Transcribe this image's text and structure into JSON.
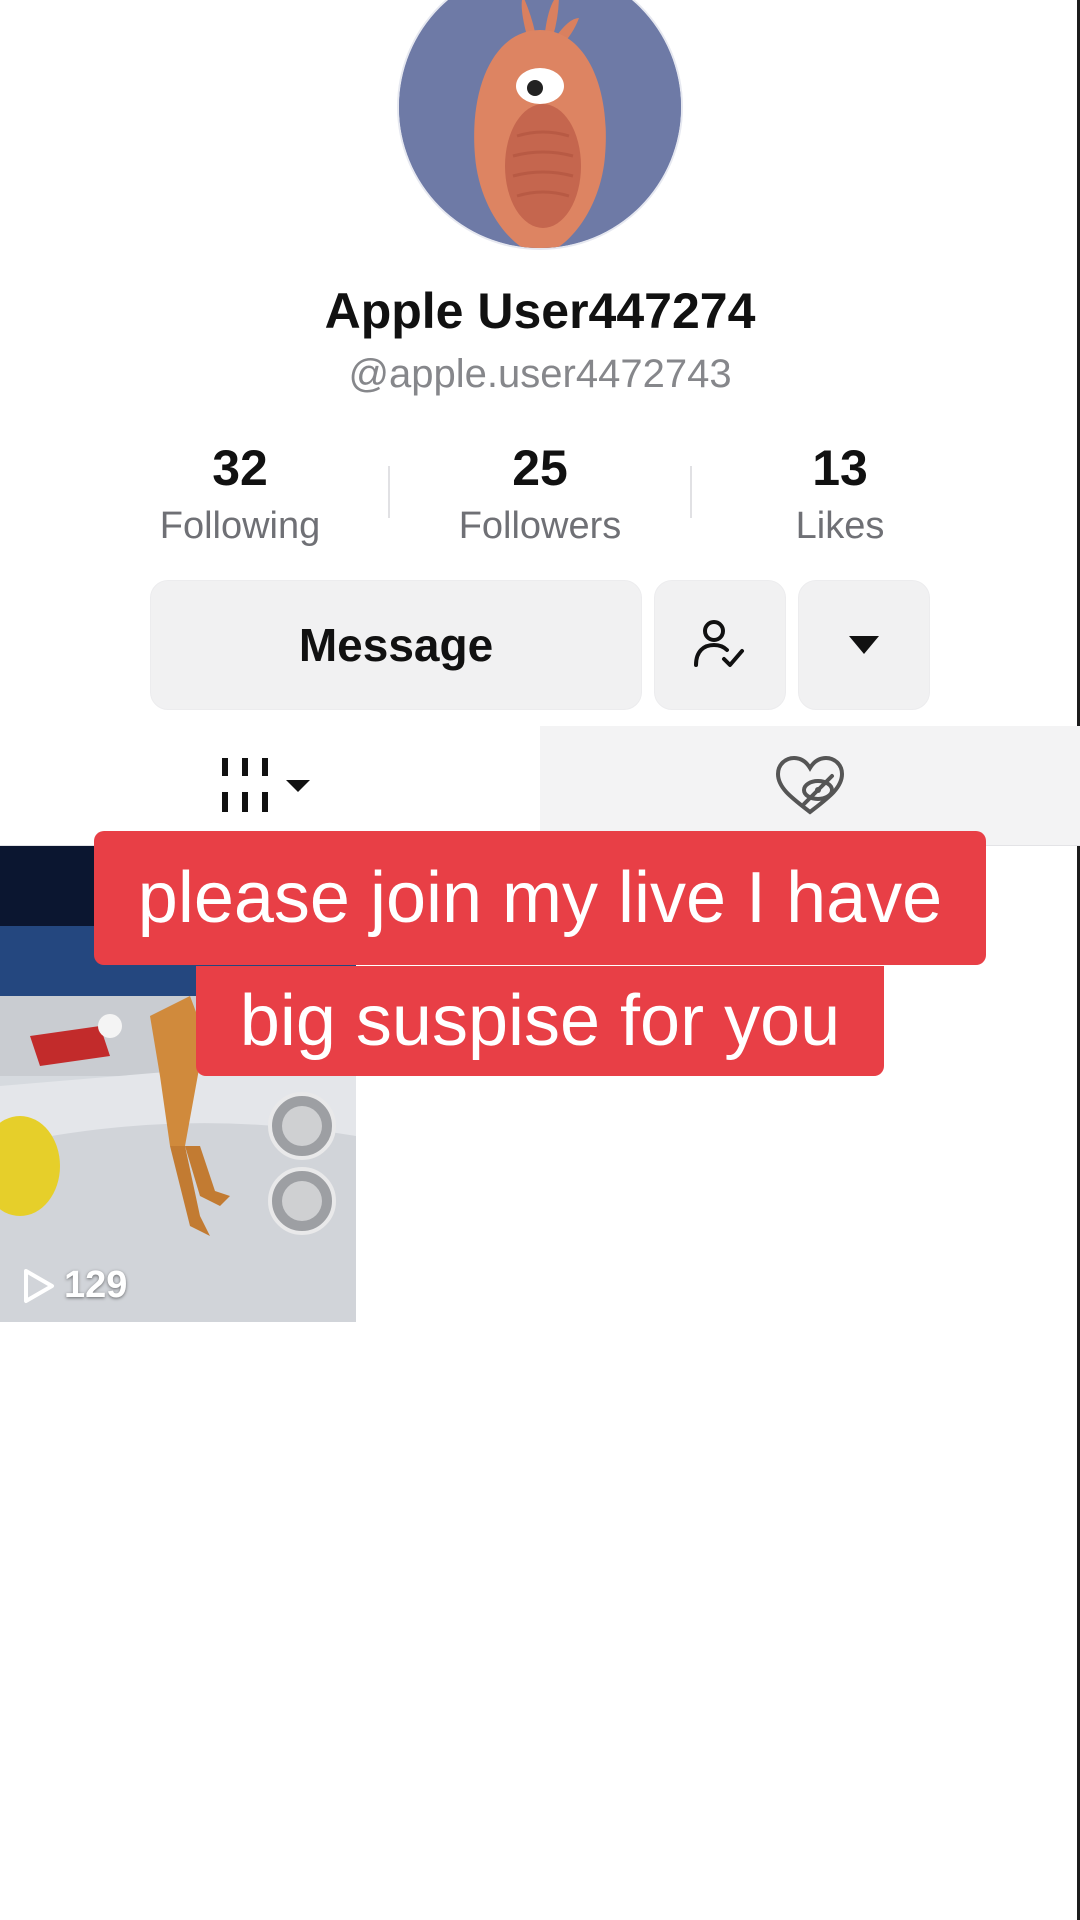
{
  "profile": {
    "display_name": "Apple User447274",
    "username": "@apple.user4472743"
  },
  "stats": {
    "following": {
      "value": "32",
      "label": "Following"
    },
    "followers": {
      "value": "25",
      "label": "Followers"
    },
    "likes": {
      "value": "13",
      "label": "Likes"
    }
  },
  "actions": {
    "message_label": "Message",
    "friend_icon": "person-check-icon",
    "more_icon": "caret-down-icon"
  },
  "tabs": {
    "videos_icon": "grid-icon",
    "liked_icon": "hidden-heart-icon"
  },
  "videos": [
    {
      "views": "129"
    }
  ],
  "caption": {
    "line1": "please join my live I have",
    "line2": "big suspise for you"
  },
  "colors": {
    "caption_bg": "#e83f46",
    "avatar_bg": "#6e7aa6",
    "button_bg": "#f1f1f2"
  }
}
